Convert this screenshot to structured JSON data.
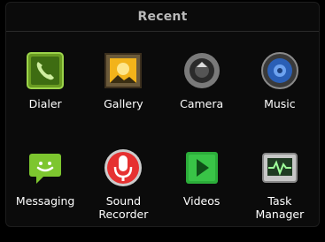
{
  "dialog": {
    "title": "Recent"
  },
  "apps": [
    {
      "label": "Dialer",
      "icon": "phone-icon"
    },
    {
      "label": "Gallery",
      "icon": "gallery-icon"
    },
    {
      "label": "Camera",
      "icon": "camera-icon"
    },
    {
      "label": "Music",
      "icon": "music-speaker-icon"
    },
    {
      "label": "Messaging",
      "icon": "messaging-icon"
    },
    {
      "label": "Sound\nRecorder",
      "icon": "microphone-icon"
    },
    {
      "label": "Videos",
      "icon": "play-icon"
    },
    {
      "label": "Task\nManager",
      "icon": "task-monitor-icon"
    }
  ]
}
